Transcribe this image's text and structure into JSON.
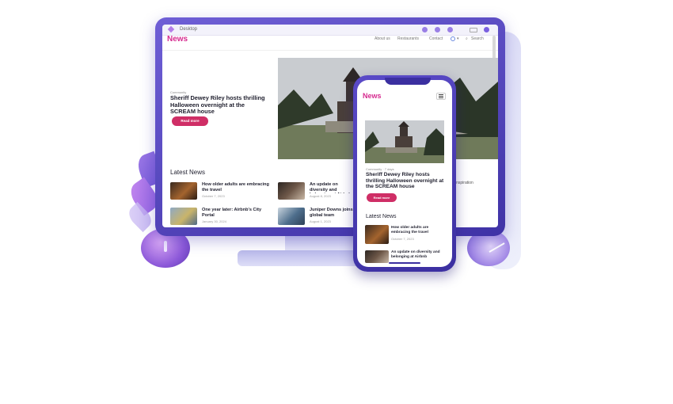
{
  "desktop": {
    "tab_title": "Desktop",
    "logo": "News",
    "nav": [
      "About us",
      "Restaurants",
      "Contact",
      "Search"
    ],
    "hero": {
      "kicker": "Community",
      "title": "Sheriff Dewey Riley hosts thrilling Halloween overnight at the SCREAM house",
      "button": "Read more"
    },
    "latest_heading": "Latest News",
    "items": [
      {
        "title": "How older adults are embracing the travel",
        "date": "October 7, 2023"
      },
      {
        "title": "An update on diversity and belonging at Airbnb",
        "date": "August 8, 2023"
      },
      {
        "title": "One year later: Airbnb's City Portal",
        "date": "January 30, 2024"
      },
      {
        "title": "Juniper Downs joins global team",
        "date": "August 1, 2023"
      }
    ],
    "side_text": "inspiration"
  },
  "mobile": {
    "logo": "News",
    "hero": {
      "kicker": "Community · 7 days",
      "title": "Sheriff Dewey Riley hosts thrilling Halloween overnight at the SCREAM house",
      "button": "Read more"
    },
    "latest_heading": "Latest News",
    "items": [
      {
        "title": "How older adults are embracing the travel",
        "date": "October 7, 2023"
      },
      {
        "title": "An update on diversity and belonging at Airbnb",
        "date": ""
      }
    ]
  },
  "colors": {
    "brand": "#d62a8f",
    "button": "#cf2e66",
    "frame": "#4a3db8"
  },
  "icons": [
    "menu-icon",
    "search-icon",
    "globe-icon"
  ]
}
